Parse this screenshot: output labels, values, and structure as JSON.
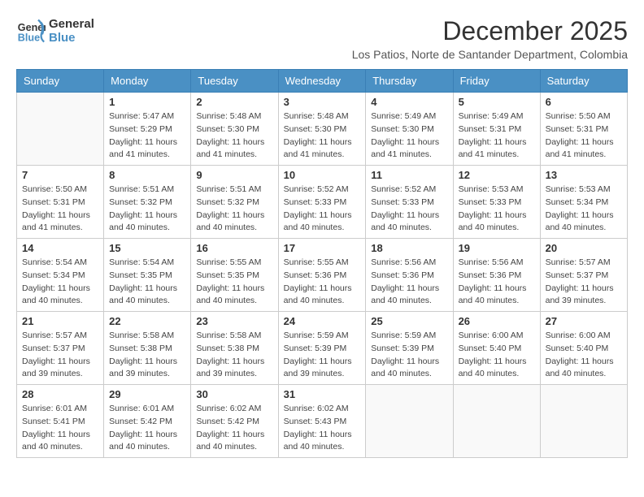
{
  "logo": {
    "line1": "General",
    "line2": "Blue"
  },
  "title": "December 2025",
  "subtitle": "Los Patios, Norte de Santander Department, Colombia",
  "weekdays": [
    "Sunday",
    "Monday",
    "Tuesday",
    "Wednesday",
    "Thursday",
    "Friday",
    "Saturday"
  ],
  "weeks": [
    [
      {
        "day": "",
        "sunrise": "",
        "sunset": "",
        "daylight": ""
      },
      {
        "day": "1",
        "sunrise": "Sunrise: 5:47 AM",
        "sunset": "Sunset: 5:29 PM",
        "daylight": "Daylight: 11 hours and 41 minutes."
      },
      {
        "day": "2",
        "sunrise": "Sunrise: 5:48 AM",
        "sunset": "Sunset: 5:30 PM",
        "daylight": "Daylight: 11 hours and 41 minutes."
      },
      {
        "day": "3",
        "sunrise": "Sunrise: 5:48 AM",
        "sunset": "Sunset: 5:30 PM",
        "daylight": "Daylight: 11 hours and 41 minutes."
      },
      {
        "day": "4",
        "sunrise": "Sunrise: 5:49 AM",
        "sunset": "Sunset: 5:30 PM",
        "daylight": "Daylight: 11 hours and 41 minutes."
      },
      {
        "day": "5",
        "sunrise": "Sunrise: 5:49 AM",
        "sunset": "Sunset: 5:31 PM",
        "daylight": "Daylight: 11 hours and 41 minutes."
      },
      {
        "day": "6",
        "sunrise": "Sunrise: 5:50 AM",
        "sunset": "Sunset: 5:31 PM",
        "daylight": "Daylight: 11 hours and 41 minutes."
      }
    ],
    [
      {
        "day": "7",
        "sunrise": "Sunrise: 5:50 AM",
        "sunset": "Sunset: 5:31 PM",
        "daylight": "Daylight: 11 hours and 41 minutes."
      },
      {
        "day": "8",
        "sunrise": "Sunrise: 5:51 AM",
        "sunset": "Sunset: 5:32 PM",
        "daylight": "Daylight: 11 hours and 40 minutes."
      },
      {
        "day": "9",
        "sunrise": "Sunrise: 5:51 AM",
        "sunset": "Sunset: 5:32 PM",
        "daylight": "Daylight: 11 hours and 40 minutes."
      },
      {
        "day": "10",
        "sunrise": "Sunrise: 5:52 AM",
        "sunset": "Sunset: 5:33 PM",
        "daylight": "Daylight: 11 hours and 40 minutes."
      },
      {
        "day": "11",
        "sunrise": "Sunrise: 5:52 AM",
        "sunset": "Sunset: 5:33 PM",
        "daylight": "Daylight: 11 hours and 40 minutes."
      },
      {
        "day": "12",
        "sunrise": "Sunrise: 5:53 AM",
        "sunset": "Sunset: 5:33 PM",
        "daylight": "Daylight: 11 hours and 40 minutes."
      },
      {
        "day": "13",
        "sunrise": "Sunrise: 5:53 AM",
        "sunset": "Sunset: 5:34 PM",
        "daylight": "Daylight: 11 hours and 40 minutes."
      }
    ],
    [
      {
        "day": "14",
        "sunrise": "Sunrise: 5:54 AM",
        "sunset": "Sunset: 5:34 PM",
        "daylight": "Daylight: 11 hours and 40 minutes."
      },
      {
        "day": "15",
        "sunrise": "Sunrise: 5:54 AM",
        "sunset": "Sunset: 5:35 PM",
        "daylight": "Daylight: 11 hours and 40 minutes."
      },
      {
        "day": "16",
        "sunrise": "Sunrise: 5:55 AM",
        "sunset": "Sunset: 5:35 PM",
        "daylight": "Daylight: 11 hours and 40 minutes."
      },
      {
        "day": "17",
        "sunrise": "Sunrise: 5:55 AM",
        "sunset": "Sunset: 5:36 PM",
        "daylight": "Daylight: 11 hours and 40 minutes."
      },
      {
        "day": "18",
        "sunrise": "Sunrise: 5:56 AM",
        "sunset": "Sunset: 5:36 PM",
        "daylight": "Daylight: 11 hours and 40 minutes."
      },
      {
        "day": "19",
        "sunrise": "Sunrise: 5:56 AM",
        "sunset": "Sunset: 5:36 PM",
        "daylight": "Daylight: 11 hours and 40 minutes."
      },
      {
        "day": "20",
        "sunrise": "Sunrise: 5:57 AM",
        "sunset": "Sunset: 5:37 PM",
        "daylight": "Daylight: 11 hours and 39 minutes."
      }
    ],
    [
      {
        "day": "21",
        "sunrise": "Sunrise: 5:57 AM",
        "sunset": "Sunset: 5:37 PM",
        "daylight": "Daylight: 11 hours and 39 minutes."
      },
      {
        "day": "22",
        "sunrise": "Sunrise: 5:58 AM",
        "sunset": "Sunset: 5:38 PM",
        "daylight": "Daylight: 11 hours and 39 minutes."
      },
      {
        "day": "23",
        "sunrise": "Sunrise: 5:58 AM",
        "sunset": "Sunset: 5:38 PM",
        "daylight": "Daylight: 11 hours and 39 minutes."
      },
      {
        "day": "24",
        "sunrise": "Sunrise: 5:59 AM",
        "sunset": "Sunset: 5:39 PM",
        "daylight": "Daylight: 11 hours and 39 minutes."
      },
      {
        "day": "25",
        "sunrise": "Sunrise: 5:59 AM",
        "sunset": "Sunset: 5:39 PM",
        "daylight": "Daylight: 11 hours and 40 minutes."
      },
      {
        "day": "26",
        "sunrise": "Sunrise: 6:00 AM",
        "sunset": "Sunset: 5:40 PM",
        "daylight": "Daylight: 11 hours and 40 minutes."
      },
      {
        "day": "27",
        "sunrise": "Sunrise: 6:00 AM",
        "sunset": "Sunset: 5:40 PM",
        "daylight": "Daylight: 11 hours and 40 minutes."
      }
    ],
    [
      {
        "day": "28",
        "sunrise": "Sunrise: 6:01 AM",
        "sunset": "Sunset: 5:41 PM",
        "daylight": "Daylight: 11 hours and 40 minutes."
      },
      {
        "day": "29",
        "sunrise": "Sunrise: 6:01 AM",
        "sunset": "Sunset: 5:42 PM",
        "daylight": "Daylight: 11 hours and 40 minutes."
      },
      {
        "day": "30",
        "sunrise": "Sunrise: 6:02 AM",
        "sunset": "Sunset: 5:42 PM",
        "daylight": "Daylight: 11 hours and 40 minutes."
      },
      {
        "day": "31",
        "sunrise": "Sunrise: 6:02 AM",
        "sunset": "Sunset: 5:43 PM",
        "daylight": "Daylight: 11 hours and 40 minutes."
      },
      {
        "day": "",
        "sunrise": "",
        "sunset": "",
        "daylight": ""
      },
      {
        "day": "",
        "sunrise": "",
        "sunset": "",
        "daylight": ""
      },
      {
        "day": "",
        "sunrise": "",
        "sunset": "",
        "daylight": ""
      }
    ]
  ]
}
